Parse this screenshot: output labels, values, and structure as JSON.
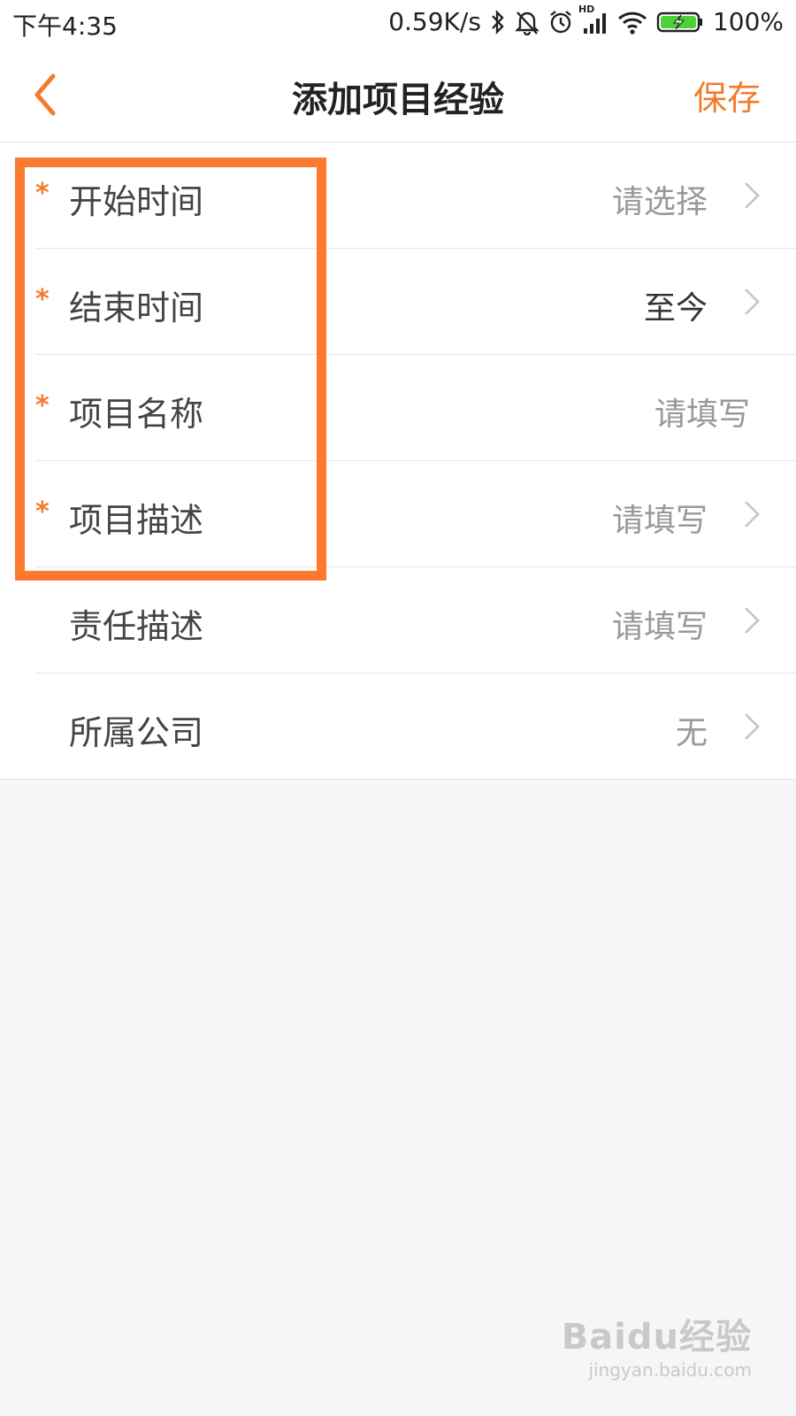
{
  "status_bar": {
    "time": "下午4:35",
    "net_speed": "0.59K/s",
    "network_badge": "HD",
    "battery": "100%"
  },
  "header": {
    "title": "添加项目经验",
    "save_label": "保存"
  },
  "form": {
    "required_mark": "*",
    "rows": [
      {
        "label": "开始时间",
        "value": "请选择"
      },
      {
        "label": "结束时间",
        "value": "至今"
      },
      {
        "label": "项目名称",
        "value": "请填写"
      },
      {
        "label": "项目描述",
        "value": "请填写"
      },
      {
        "label": "责任描述",
        "value": "请填写"
      },
      {
        "label": "所属公司",
        "value": "无"
      }
    ]
  },
  "colors": {
    "accent": "#f37b2e",
    "highlight": "#fb7a30",
    "placeholder": "#999999",
    "background": "#f6f5f8"
  },
  "watermark": {
    "brand": "Baidu经验",
    "url": "jingyan.baidu.com"
  }
}
